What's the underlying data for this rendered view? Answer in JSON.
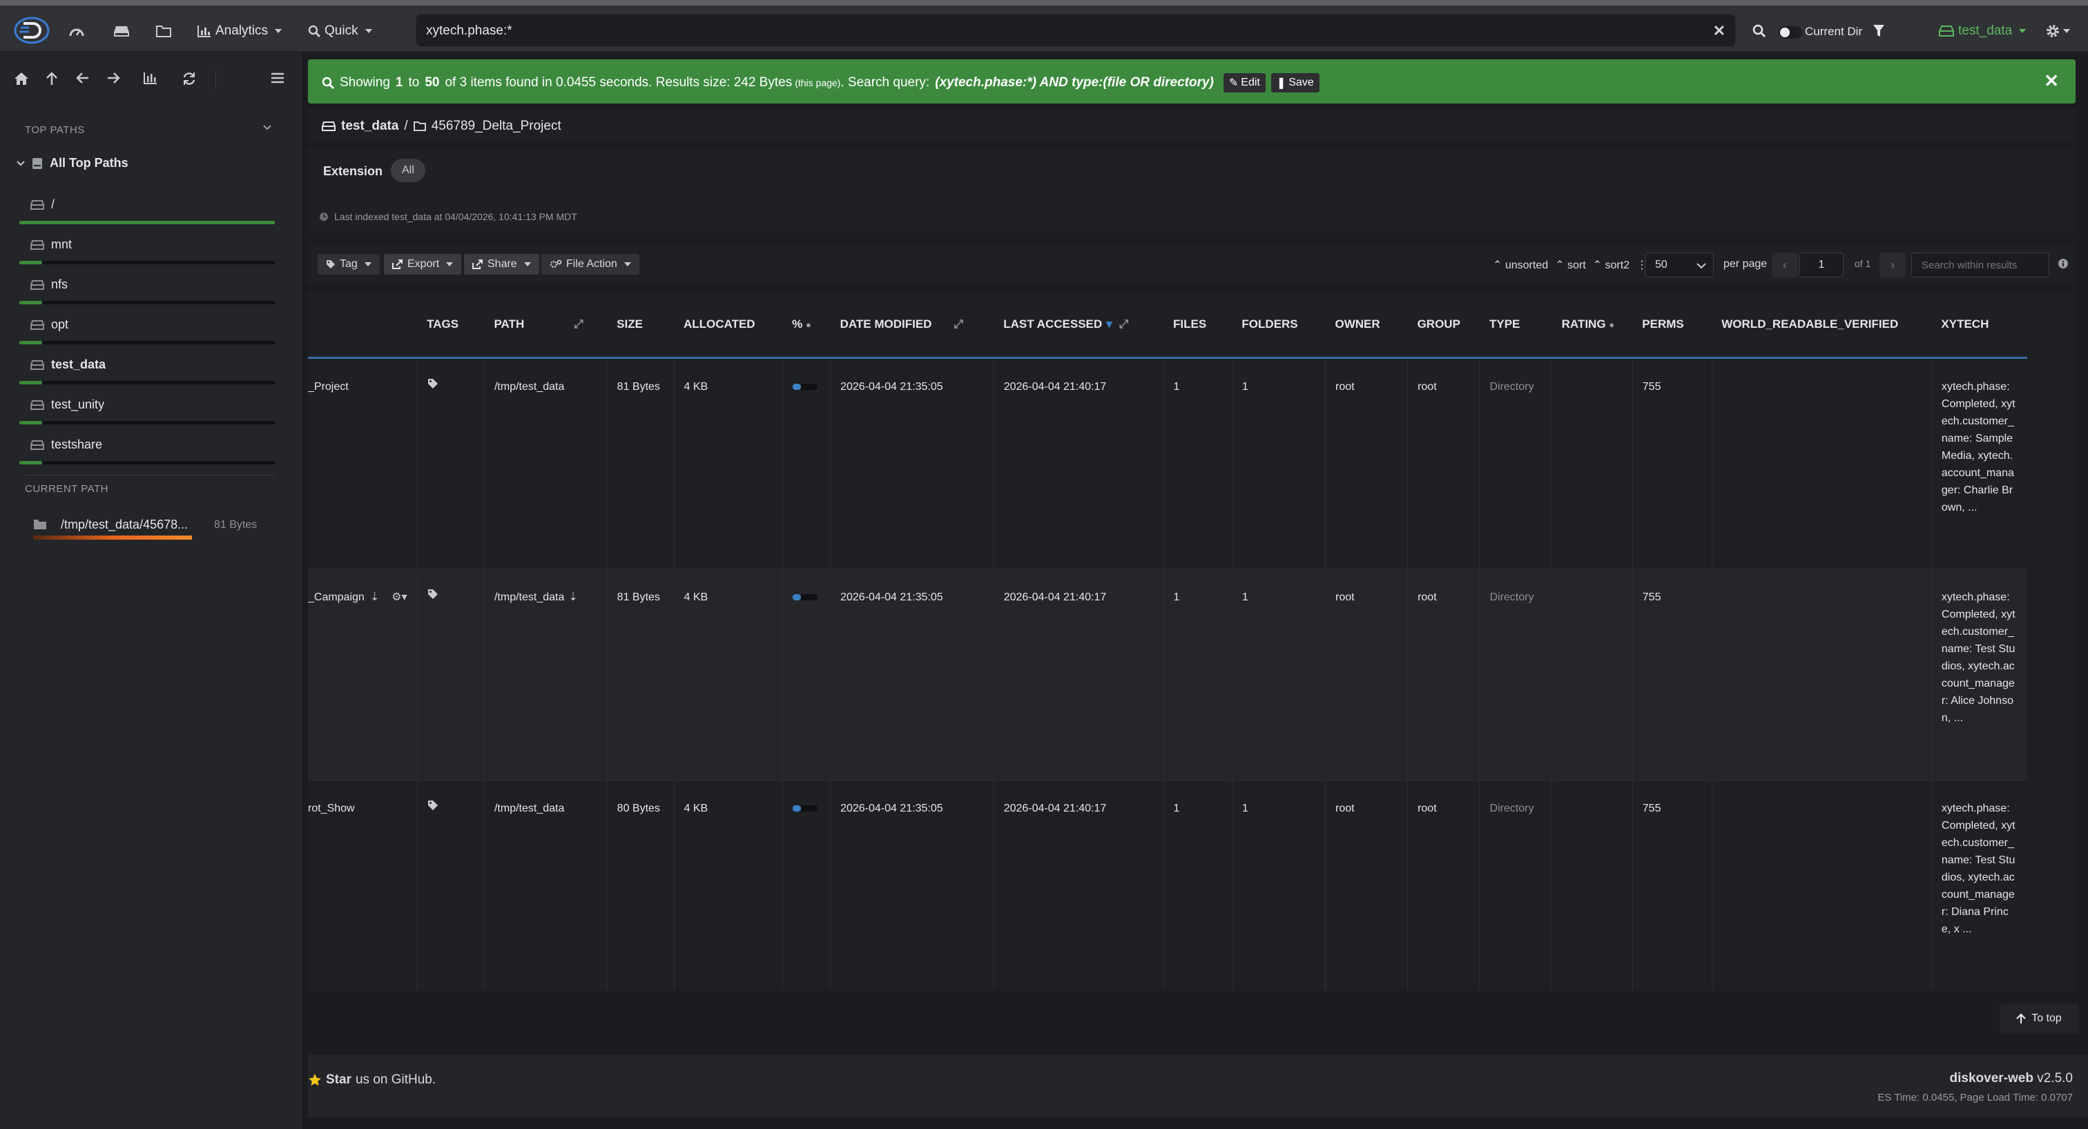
{
  "topbar": {
    "analytics_label": "Analytics",
    "quick_label": "Quick",
    "search_value": "xytech.phase:*",
    "current_dir_label": "Current Dir",
    "index_label": "test_data"
  },
  "sidebar": {
    "top_paths_title": "TOP PATHS",
    "all_top_paths": "All Top Paths",
    "items": [
      {
        "label": "/",
        "fill": 1.0
      },
      {
        "label": "mnt",
        "fill": 0.09
      },
      {
        "label": "nfs",
        "fill": 0.09
      },
      {
        "label": "opt",
        "fill": 0.09
      },
      {
        "label": "test_data",
        "fill": 0.09
      },
      {
        "label": "test_unity",
        "fill": 0.09
      },
      {
        "label": "testshare",
        "fill": 0.09
      }
    ],
    "current_path_title": "CURRENT PATH",
    "current_path": "/tmp/test_data/45678...",
    "current_size": "81 Bytes"
  },
  "alert": {
    "showing": "Showing",
    "from": "1",
    "to_word": "to",
    "to": "50",
    "rest": "of 3 items found in 0.0455 seconds. Results size: 242 Bytes",
    "this_page": "(this page)",
    "query_label": ". Search query:",
    "query": "(xytech.phase:*) AND type:(file OR directory)",
    "edit_label": "Edit",
    "save_label": "Save"
  },
  "breadcrumb": {
    "root": "test_data",
    "sep": "/",
    "folder": "456789_Delta_Project"
  },
  "filters": {
    "extension_label": "Extension",
    "all_pill": "All",
    "last_indexed": "Last indexed test_data at 04/04/2026, 10:41:13 PM MDT"
  },
  "toolbar": {
    "tag": "Tag",
    "export": "Export",
    "share": "Share",
    "file_action": "File Action",
    "unsorted": "unsorted",
    "sort": "sort",
    "sort2": "sort2",
    "per_page_value": "50",
    "per_page_label": "per page",
    "page": "1",
    "of": "of 1",
    "search_within_placeholder": "Search within results"
  },
  "table": {
    "headers": [
      "TAGS",
      "PATH",
      "SIZE",
      "ALLOCATED",
      "%",
      "DATE MODIFIED",
      "LAST ACCESSED",
      "FILES",
      "FOLDERS",
      "OWNER",
      "GROUP",
      "TYPE",
      "RATING",
      "PERMS",
      "WORLD_READABLE_VERIFIED",
      "XYTECH"
    ],
    "rows": [
      {
        "name": "_Project",
        "path": "/tmp/test_data",
        "size": "81 Bytes",
        "allocated": "4 KB",
        "pct": 0.33,
        "modified": "2026-04-04 21:35:05",
        "accessed": "2026-04-04 21:40:17",
        "files": "1",
        "folders": "1",
        "owner": "root",
        "group": "root",
        "type": "Directory",
        "perms": "755",
        "xytech": "xytech.phase: Completed, xytech.customer_name: Sample Media, xytech.account_manager: Charlie Brown, ..."
      },
      {
        "name": "_Campaign",
        "path": "/tmp/test_data",
        "size": "81 Bytes",
        "allocated": "4 KB",
        "pct": 0.33,
        "modified": "2026-04-04 21:35:05",
        "accessed": "2026-04-04 21:40:17",
        "files": "1",
        "folders": "1",
        "owner": "root",
        "group": "root",
        "type": "Directory",
        "perms": "755",
        "xytech": "xytech.phase: Completed, xytech.customer_name: Test Studios, xytech.account_manager: Alice Johnson, ..."
      },
      {
        "name": "rot_Show",
        "path": "/tmp/test_data",
        "size": "80 Bytes",
        "allocated": "4 KB",
        "pct": 0.33,
        "modified": "2026-04-04 21:35:05",
        "accessed": "2026-04-04 21:40:17",
        "files": "1",
        "folders": "1",
        "owner": "root",
        "group": "root",
        "type": "Directory",
        "perms": "755",
        "xytech": "xytech.phase: Completed, xytech.customer_name: Test Studios, xytech.account_manager: Diana Prince, x ..."
      }
    ]
  },
  "footer": {
    "to_top": "To top",
    "star_bold": "Star",
    "star_rest": "us on GitHub.",
    "app_name": "diskover-web",
    "version": "v2.5.0",
    "es_time": "ES Time: 0.0455, Page Load Time: 0.0707"
  },
  "colors": {
    "alert_green": "#3d8a3f",
    "accent_blue": "#3b82c4",
    "index_green": "#5cb85c",
    "progress_orange": "#e8641c"
  }
}
